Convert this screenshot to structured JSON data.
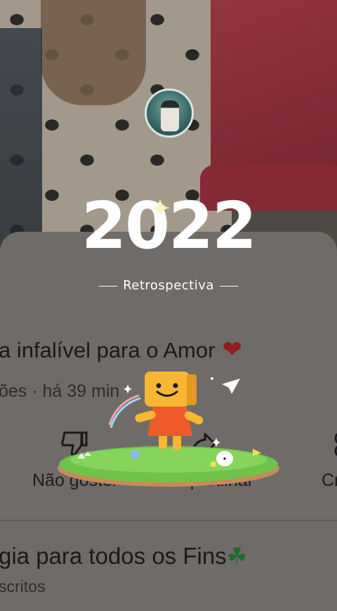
{
  "overlay": {
    "year": "2022",
    "subtitle": "Retrospectiva"
  },
  "video": {
    "title": "a infalível para o Amor",
    "title_emoji": "❤",
    "meta": "ões · há 39 min"
  },
  "actions": [
    {
      "label": "Não gostei",
      "icon": "dislike-icon"
    },
    {
      "label": "Compartilhar",
      "icon": "share-icon"
    },
    {
      "label": "Cr",
      "icon": "create-icon"
    }
  ],
  "next_video": {
    "title": "gia para todos os Fins",
    "title_emoji": "☘",
    "meta": "scritos"
  },
  "colors": {
    "overlay_text": "#ffffff",
    "dim_card": "#6f6b69",
    "heart": "#8e1f1f",
    "clover": "#1f6b2a",
    "mascot_head": "#f7b733",
    "mascot_body": "#ef5a2a",
    "grass": "#6fc24a"
  }
}
